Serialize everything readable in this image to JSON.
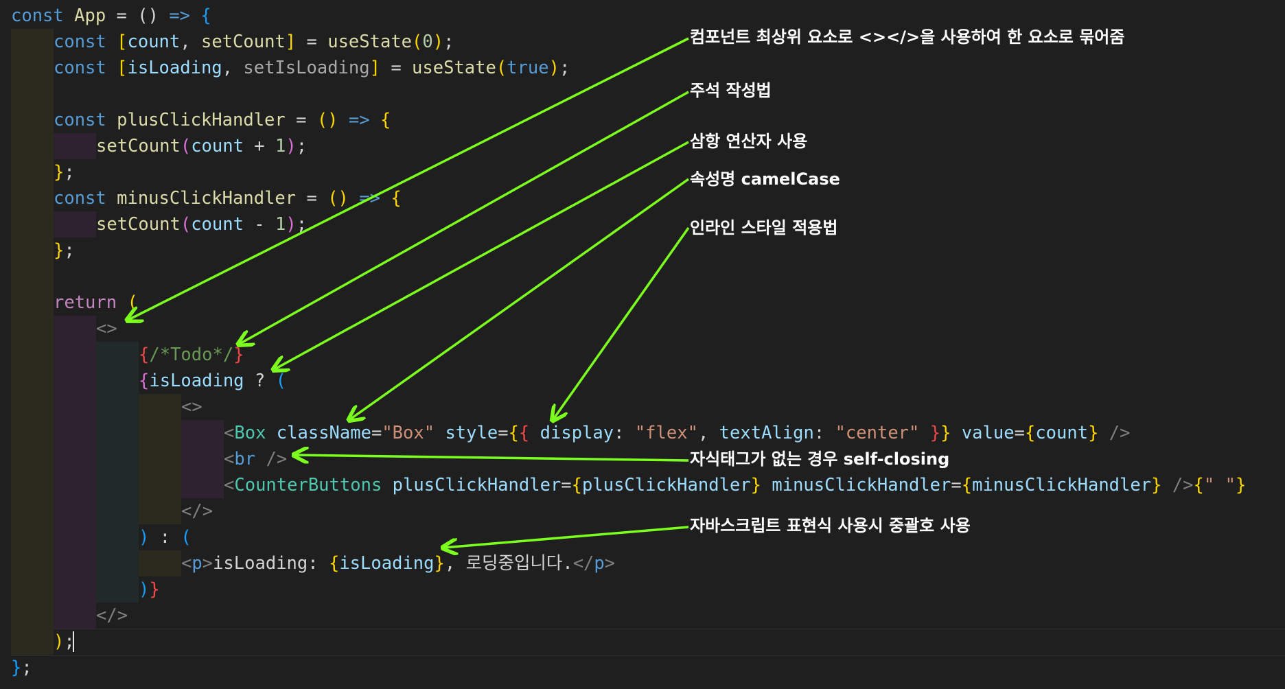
{
  "colors": {
    "background": "#1f1f1f",
    "guide_olive": "#2b2a1e",
    "guide_purple": "#2e2230",
    "guide_teal": "#21292b",
    "arrow": "#7cff1e",
    "annotation_text": "#ffffff"
  },
  "code": {
    "lines": [
      {
        "depth": 0,
        "tokens": [
          [
            "kw",
            "const"
          ],
          [
            "p",
            " "
          ],
          [
            "fn",
            "App"
          ],
          [
            "p",
            " = "
          ],
          [
            "pl",
            "()"
          ],
          [
            "p",
            " "
          ],
          [
            "ar",
            "=>"
          ],
          [
            "p",
            " "
          ],
          [
            "b3",
            "{"
          ]
        ]
      },
      {
        "depth": 1,
        "tokens": [
          [
            "kw",
            "const"
          ],
          [
            "p",
            " "
          ],
          [
            "b1",
            "["
          ],
          [
            "v",
            "count"
          ],
          [
            "p",
            ", "
          ],
          [
            "fn",
            "setCount"
          ],
          [
            "b1",
            "]"
          ],
          [
            "p",
            " = "
          ],
          [
            "fn",
            "useState"
          ],
          [
            "b1",
            "("
          ],
          [
            "num",
            "0"
          ],
          [
            "b1",
            ")"
          ],
          [
            "p",
            ";"
          ]
        ]
      },
      {
        "depth": 1,
        "tokens": [
          [
            "kw",
            "const"
          ],
          [
            "p",
            " "
          ],
          [
            "b1",
            "["
          ],
          [
            "v",
            "isLoading"
          ],
          [
            "p",
            ", "
          ],
          [
            "dim",
            "setIsLoading"
          ],
          [
            "b1",
            "]"
          ],
          [
            "p",
            " = "
          ],
          [
            "fn",
            "useState"
          ],
          [
            "b1",
            "("
          ],
          [
            "kw",
            "true"
          ],
          [
            "b1",
            ")"
          ],
          [
            "p",
            ";"
          ]
        ]
      },
      {
        "depth": 1,
        "tokens": []
      },
      {
        "depth": 1,
        "tokens": [
          [
            "kw",
            "const"
          ],
          [
            "p",
            " "
          ],
          [
            "fn",
            "plusClickHandler"
          ],
          [
            "p",
            " = "
          ],
          [
            "b1",
            "()"
          ],
          [
            "p",
            " "
          ],
          [
            "ar",
            "=>"
          ],
          [
            "p",
            " "
          ],
          [
            "b1",
            "{"
          ]
        ]
      },
      {
        "depth": 2,
        "tokens": [
          [
            "fn",
            "setCount"
          ],
          [
            "b2",
            "("
          ],
          [
            "v",
            "count"
          ],
          [
            "p",
            " + "
          ],
          [
            "num",
            "1"
          ],
          [
            "b2",
            ")"
          ],
          [
            "p",
            ";"
          ]
        ]
      },
      {
        "depth": 1,
        "tokens": [
          [
            "b1",
            "}"
          ],
          [
            "p",
            ";"
          ]
        ]
      },
      {
        "depth": 1,
        "tokens": [
          [
            "kw",
            "const"
          ],
          [
            "p",
            " "
          ],
          [
            "fn",
            "minusClickHandler"
          ],
          [
            "p",
            " = "
          ],
          [
            "b1",
            "()"
          ],
          [
            "p",
            " "
          ],
          [
            "ar",
            "=>"
          ],
          [
            "p",
            " "
          ],
          [
            "b1",
            "{"
          ]
        ]
      },
      {
        "depth": 2,
        "tokens": [
          [
            "fn",
            "setCount"
          ],
          [
            "b2",
            "("
          ],
          [
            "v",
            "count"
          ],
          [
            "p",
            " - "
          ],
          [
            "num",
            "1"
          ],
          [
            "b2",
            ")"
          ],
          [
            "p",
            ";"
          ]
        ]
      },
      {
        "depth": 1,
        "tokens": [
          [
            "b1",
            "}"
          ],
          [
            "p",
            ";"
          ]
        ]
      },
      {
        "depth": 1,
        "tokens": []
      },
      {
        "depth": 1,
        "tokens": [
          [
            "ctl",
            "return"
          ],
          [
            "p",
            " "
          ],
          [
            "b1",
            "("
          ]
        ]
      },
      {
        "depth": 2,
        "tokens": [
          [
            "tag",
            "<>"
          ]
        ]
      },
      {
        "depth": 3,
        "tokens": [
          [
            "b2r",
            "{"
          ],
          [
            "cm",
            "/*Todo*/"
          ],
          [
            "b2r",
            "}"
          ]
        ]
      },
      {
        "depth": 3,
        "tokens": [
          [
            "b2",
            "{"
          ],
          [
            "v",
            "isLoading"
          ],
          [
            "p",
            " ? "
          ],
          [
            "b3",
            "("
          ]
        ]
      },
      {
        "depth": 4,
        "tokens": [
          [
            "tag",
            "<>"
          ]
        ]
      },
      {
        "depth": 5,
        "tokens": [
          [
            "tag",
            "<"
          ],
          [
            "comp",
            "Box"
          ],
          [
            "p",
            " "
          ],
          [
            "attr",
            "className"
          ],
          [
            "p",
            "="
          ],
          [
            "str",
            "\"Box\""
          ],
          [
            "p",
            " "
          ],
          [
            "attr",
            "style"
          ],
          [
            "p",
            "="
          ],
          [
            "b1",
            "{"
          ],
          [
            "b2r",
            "{"
          ],
          [
            "p",
            " "
          ],
          [
            "attr",
            "display"
          ],
          [
            "p",
            ": "
          ],
          [
            "str",
            "\"flex\""
          ],
          [
            "p",
            ", "
          ],
          [
            "attr",
            "textAlign"
          ],
          [
            "p",
            ": "
          ],
          [
            "str",
            "\"center\""
          ],
          [
            "p",
            " "
          ],
          [
            "b2r",
            "}"
          ],
          [
            "b1",
            "}"
          ],
          [
            "p",
            " "
          ],
          [
            "attr",
            "value"
          ],
          [
            "p",
            "="
          ],
          [
            "b1",
            "{"
          ],
          [
            "v",
            "count"
          ],
          [
            "b1",
            "}"
          ],
          [
            "p",
            " "
          ],
          [
            "tag",
            "/>"
          ]
        ]
      },
      {
        "depth": 5,
        "tokens": [
          [
            "tag",
            "<"
          ],
          [
            "kw",
            "br"
          ],
          [
            "p",
            " "
          ],
          [
            "tag",
            "/>"
          ]
        ]
      },
      {
        "depth": 5,
        "tokens": [
          [
            "tag",
            "<"
          ],
          [
            "comp",
            "CounterButtons"
          ],
          [
            "p",
            " "
          ],
          [
            "attr",
            "plusClickHandler"
          ],
          [
            "p",
            "="
          ],
          [
            "b1",
            "{"
          ],
          [
            "attr",
            "plusClickHandler"
          ],
          [
            "b1",
            "}"
          ],
          [
            "p",
            " "
          ],
          [
            "attr",
            "minusClickHandler"
          ],
          [
            "p",
            "="
          ],
          [
            "b1",
            "{"
          ],
          [
            "attr",
            "minusClickHandler"
          ],
          [
            "b1",
            "}"
          ],
          [
            "p",
            " "
          ],
          [
            "tag",
            "/>"
          ],
          [
            "b1",
            "{"
          ],
          [
            "str",
            "\" \""
          ],
          [
            "b1",
            "}"
          ]
        ]
      },
      {
        "depth": 4,
        "tokens": [
          [
            "tag",
            "</>"
          ]
        ]
      },
      {
        "depth": 3,
        "tokens": [
          [
            "b3",
            ")"
          ],
          [
            "p",
            " : "
          ],
          [
            "b3",
            "("
          ]
        ]
      },
      {
        "depth": 4,
        "tokens": [
          [
            "tag",
            "<"
          ],
          [
            "kw",
            "p"
          ],
          [
            "tag",
            ">"
          ],
          [
            "p",
            "isLoading: "
          ],
          [
            "b1",
            "{"
          ],
          [
            "v",
            "isLoading"
          ],
          [
            "b1",
            "}"
          ],
          [
            "p",
            ", 로딩중입니다."
          ],
          [
            "tag",
            "</"
          ],
          [
            "kw",
            "p"
          ],
          [
            "tag",
            ">"
          ]
        ]
      },
      {
        "depth": 3,
        "tokens": [
          [
            "b3",
            ")"
          ],
          [
            "b2r",
            "}"
          ]
        ]
      },
      {
        "depth": 2,
        "tokens": [
          [
            "tag",
            "</>"
          ]
        ]
      },
      {
        "depth": 1,
        "tokens": [
          [
            "b1",
            ")"
          ],
          [
            "p",
            ";"
          ]
        ]
      },
      {
        "depth": 0,
        "tokens": [
          [
            "b3",
            "}"
          ],
          [
            "p",
            ";"
          ]
        ]
      }
    ]
  },
  "annotations": [
    {
      "text": "컴포넌트 최상위 요소로 <></>을 사용하여 한 요소로 묶어줌"
    },
    {
      "text": "주석 작성법"
    },
    {
      "text": "삼항 연산자 사용"
    },
    {
      "text": "속성명 camelCase"
    },
    {
      "text": "인라인 스타일 적용법"
    },
    {
      "text": "자식태그가 없는 경우 self-closing"
    },
    {
      "text": "자바스크립트 표현식 사용시 중괄호 사용"
    }
  ]
}
